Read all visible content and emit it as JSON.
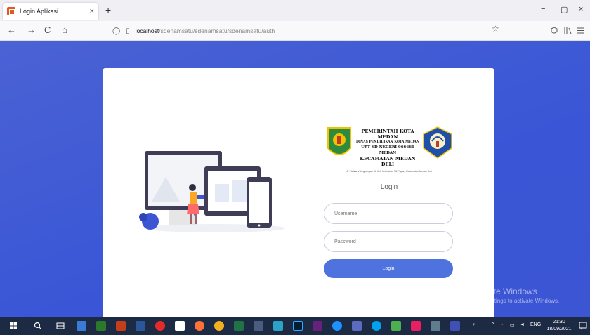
{
  "browser": {
    "tab_title": "Login Aplikasi",
    "tab_close": "×",
    "new_tab": "+",
    "url_host": "localhost",
    "url_path": "/sdenamsatu/sdenamsatu/sdenamsatu/auth",
    "back": "←",
    "forward": "→",
    "reload": "C",
    "home": "⌂",
    "minimize": "−",
    "maximize": "▢",
    "close": "×",
    "bookmark": "☆",
    "shield": "◯",
    "page_icon": "▯"
  },
  "header": {
    "line1": "PEMERINTAH KOTA MEDAN",
    "line2": "DINAS PENDIDIKAN KOTA MEDAN",
    "line3": "UPT SD NEGERI 066661 MEDAN",
    "line4": "KECAMATAN MEDAN DELI",
    "address": "Jl. Platina V Lingkungan XII Kel. Kelurahan Titi Papan, Kecamatan Medan Deli"
  },
  "login": {
    "title": "Login",
    "username_placeholder": "Username",
    "password_placeholder": "Password",
    "button": "Login"
  },
  "watermark": {
    "title": "Activate Windows",
    "subtitle": "Go to Settings to activate Windows."
  },
  "taskbar": {
    "time": "21:30",
    "date": "18/09/2021",
    "lang": "ENG"
  },
  "colors": {
    "page_bg": "#3b55d3",
    "button": "#4e73df",
    "taskbar": "#1c2a44"
  }
}
